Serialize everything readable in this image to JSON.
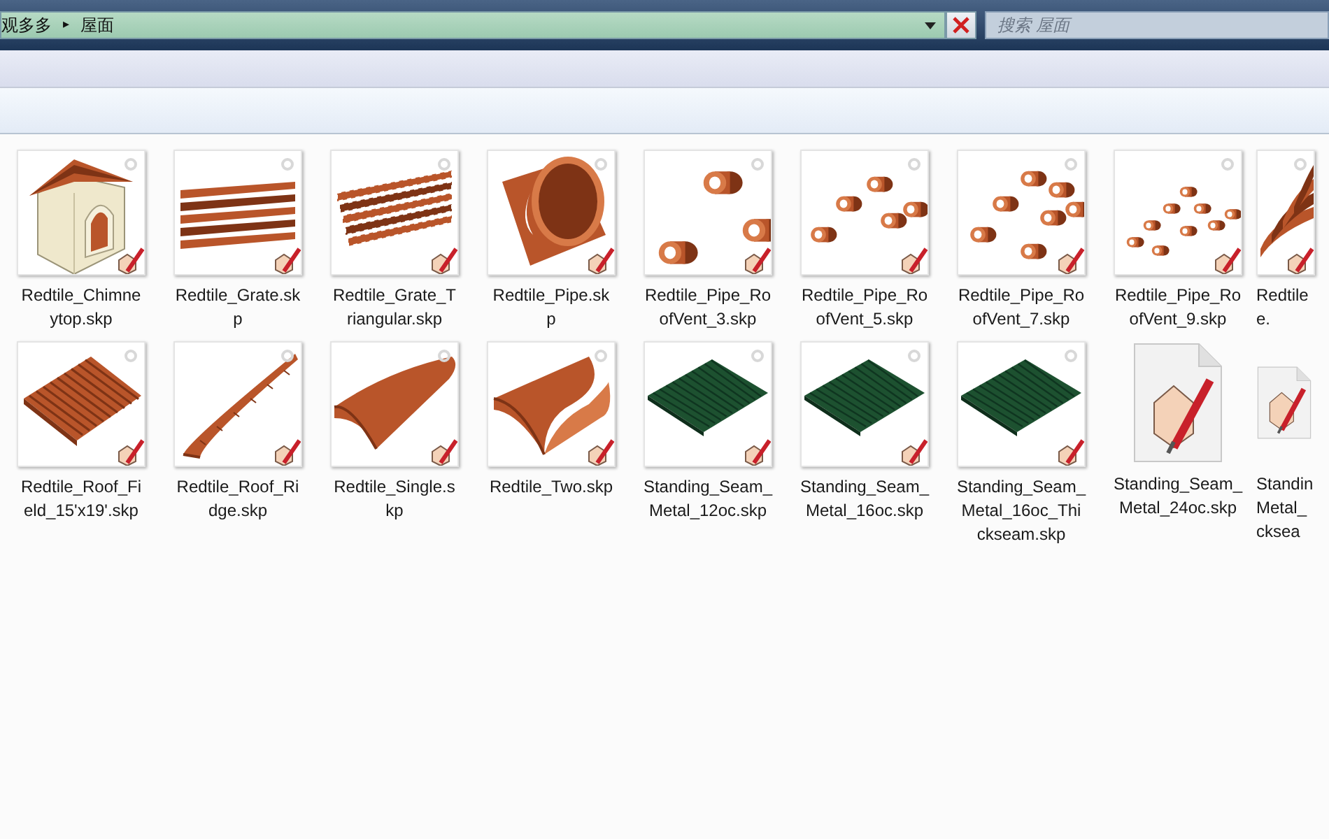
{
  "address_bar": {
    "crumbs": [
      "观多多",
      "屋面"
    ],
    "separator": "▸"
  },
  "search": {
    "placeholder": "搜索 屋面"
  },
  "files": [
    {
      "kind": "chimney",
      "lines": [
        "Redtile_Chimne",
        "ytop.skp"
      ]
    },
    {
      "kind": "grate",
      "lines": [
        "Redtile_Grate.sk",
        "p"
      ]
    },
    {
      "kind": "triangular",
      "lines": [
        "Redtile_Grate_T",
        "riangular.skp"
      ]
    },
    {
      "kind": "pipe",
      "lines": [
        "Redtile_Pipe.sk",
        "p"
      ]
    },
    {
      "kind": "vents3",
      "lines": [
        "Redtile_Pipe_Ro",
        "ofVent_3.skp"
      ]
    },
    {
      "kind": "vents5",
      "lines": [
        "Redtile_Pipe_Ro",
        "ofVent_5.skp"
      ]
    },
    {
      "kind": "vents7",
      "lines": [
        "Redtile_Pipe_Ro",
        "ofVent_7.skp"
      ]
    },
    {
      "kind": "vents9",
      "lines": [
        "Redtile_Pipe_Ro",
        "ofVent_9.skp"
      ]
    },
    {
      "kind": "wave",
      "lines": [
        "Redtile",
        "e."
      ],
      "clipped": true
    },
    {
      "kind": "field",
      "lines": [
        "Redtile_Roof_Fi",
        "eld_15'x19'.skp"
      ]
    },
    {
      "kind": "ridge",
      "lines": [
        "Redtile_Roof_Ri",
        "dge.skp"
      ]
    },
    {
      "kind": "single",
      "lines": [
        "Redtile_Single.s",
        "kp"
      ]
    },
    {
      "kind": "two",
      "lines": [
        "Redtile_Two.skp"
      ]
    },
    {
      "kind": "metal",
      "lines": [
        "Standing_Seam_",
        "Metal_12oc.skp"
      ]
    },
    {
      "kind": "metal",
      "lines": [
        "Standing_Seam_",
        "Metal_16oc.skp"
      ]
    },
    {
      "kind": "metal",
      "lines": [
        "Standing_Seam_",
        "Metal_16oc_Thi",
        "ckseam.skp"
      ]
    },
    {
      "kind": "document",
      "lines": [
        "Standing_Seam_",
        "Metal_24oc.skp"
      ]
    },
    {
      "kind": "document",
      "lines": [
        "Standin",
        "Metal_",
        "cksea"
      ],
      "clipped": true
    }
  ]
}
